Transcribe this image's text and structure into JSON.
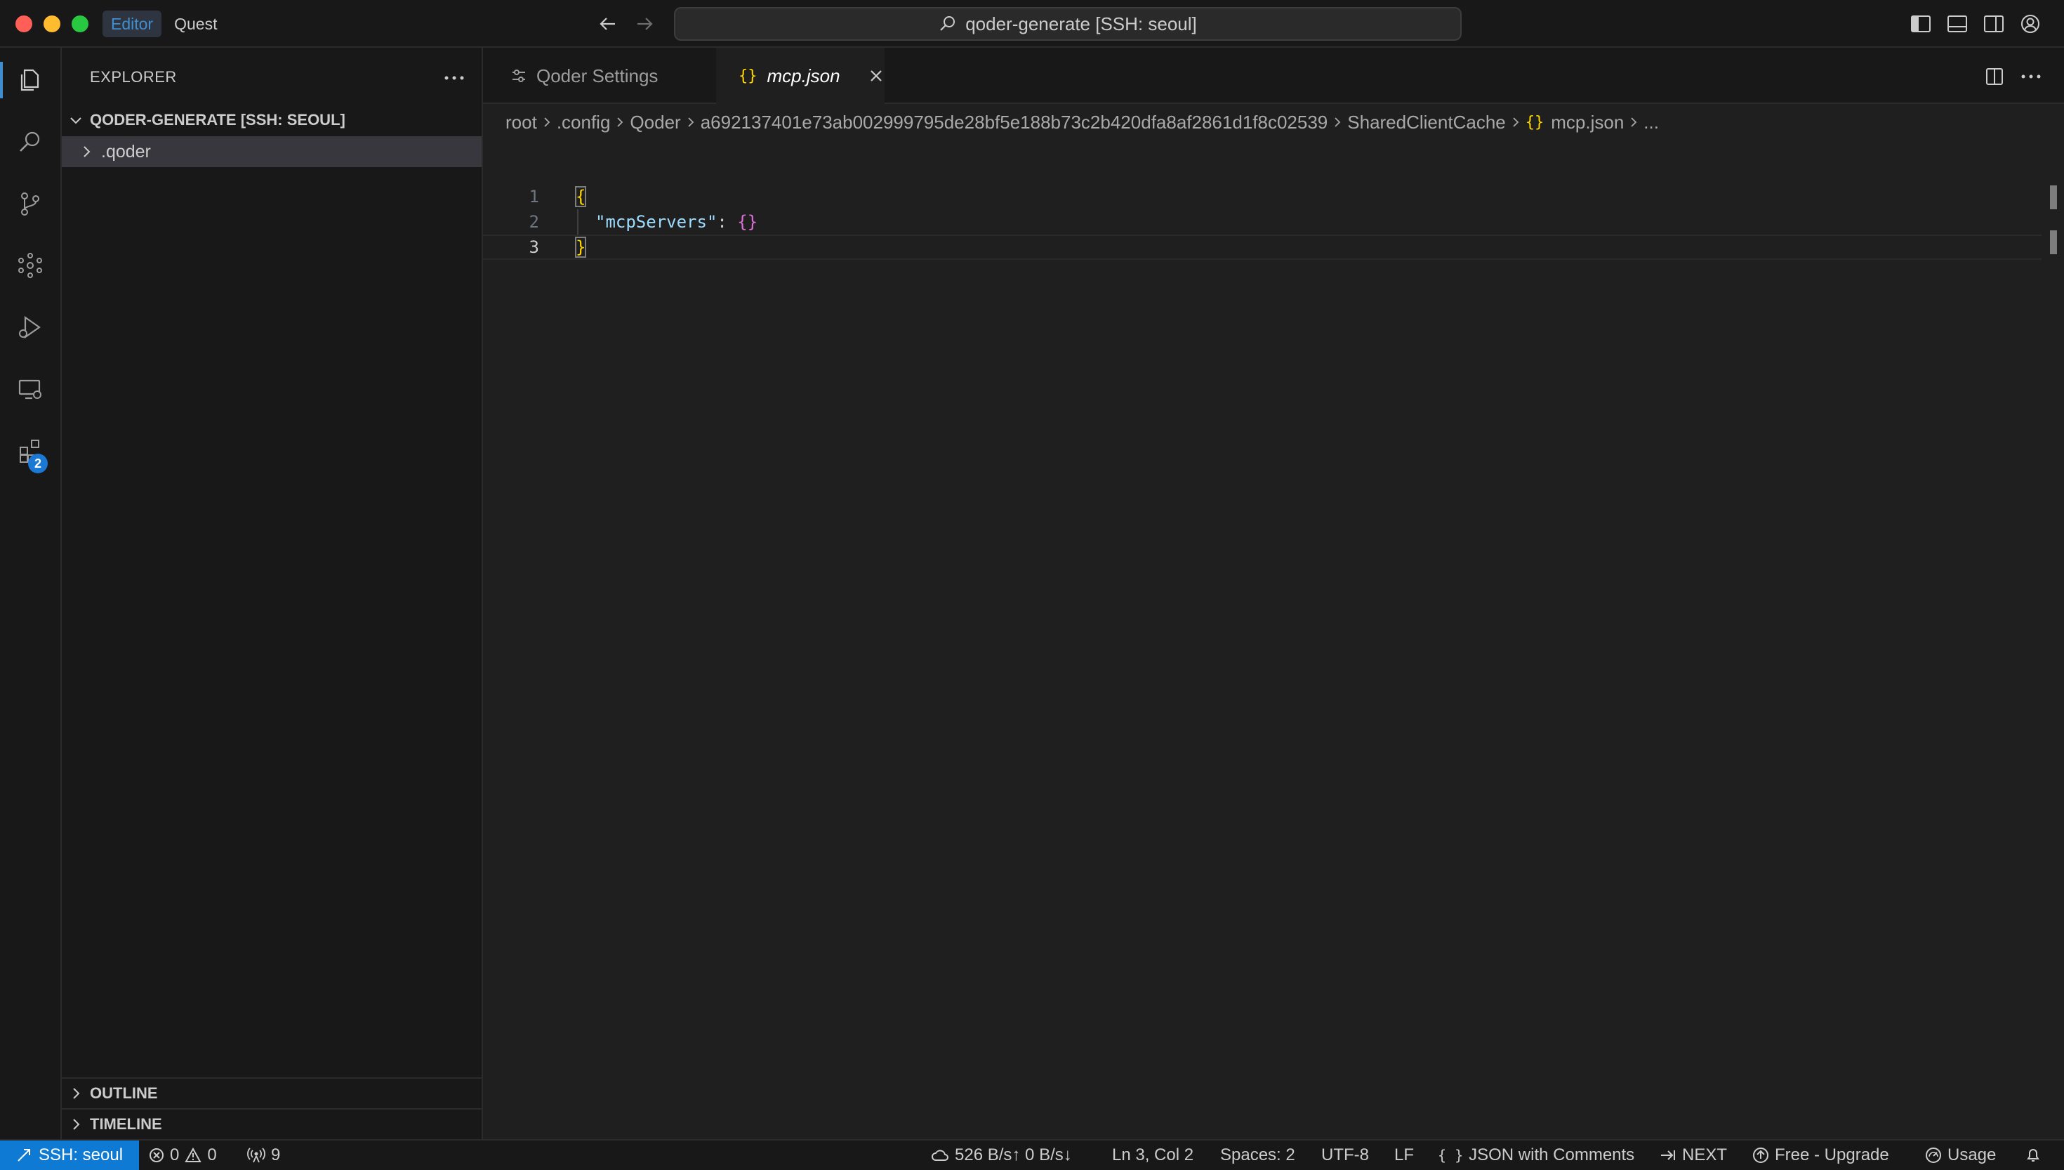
{
  "window": {
    "title": "qoder-generate [SSH: seoul]"
  },
  "mode_tabs": [
    {
      "label": "Editor",
      "active": true
    },
    {
      "label": "Quest",
      "active": false
    }
  ],
  "activity_bar": {
    "items": [
      "explorer",
      "search",
      "source-control",
      "agents",
      "run-and-debug",
      "remote-explorer",
      "extensions"
    ],
    "extensions_badge": "2"
  },
  "sidebar": {
    "title": "EXPLORER",
    "folder": "QODER-GENERATE [SSH: SEOUL]",
    "tree": [
      {
        "label": ".qoder",
        "type": "folder",
        "expanded": false
      }
    ],
    "outline_label": "OUTLINE",
    "timeline_label": "TIMELINE"
  },
  "tabs": [
    {
      "label": "Qoder Settings",
      "active": false
    },
    {
      "label": "mcp.json",
      "active": true,
      "icon": "{}"
    }
  ],
  "breadcrumbs": [
    "root",
    ".config",
    "Qoder",
    "a692137401e73ab002999795de28bf5e188b73c2b420dfa8af2861d1f8c02539",
    "SharedClientCache",
    "mcp.json",
    "..."
  ],
  "breadcrumb_file_icon": "{}",
  "code": {
    "line_numbers": [
      "1",
      "2",
      "3"
    ],
    "line1": "{",
    "line2_key": "\"mcpServers\"",
    "line2_colon": ": ",
    "line2_value": "{}",
    "line3": "}",
    "current_line": 3
  },
  "statusbar": {
    "remote": "SSH: seoul",
    "errors": "0",
    "warnings": "0",
    "ports": "9",
    "network": "526 B/s↑ 0 B/s↓",
    "cursor": "Ln 3, Col 2",
    "spaces": "Spaces: 2",
    "encoding": "UTF-8",
    "eol": "LF",
    "language": "JSON with Comments",
    "language_icon": "{ }",
    "next": "NEXT",
    "plan": "Free - Upgrade",
    "usage": "Usage"
  },
  "colors": {
    "accent": "#3e8ed0",
    "remote_bg": "#0e7ad3",
    "bracket_yellow": "#ffd700",
    "bracket_purple": "#da70d6",
    "json_key": "#9cdcfe"
  }
}
